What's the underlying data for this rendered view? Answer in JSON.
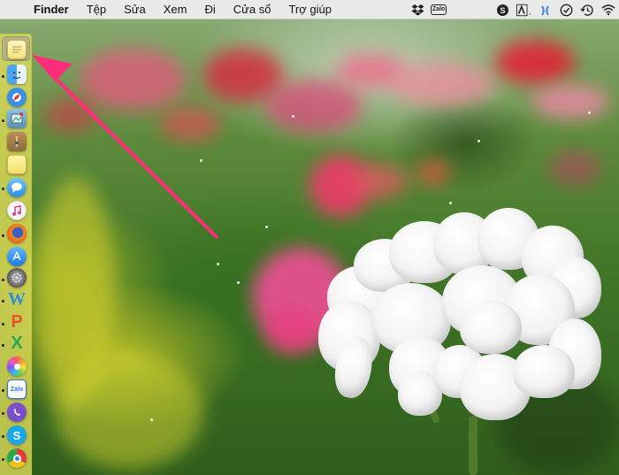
{
  "menubar": {
    "apple_icon": "",
    "app_name": "Finder",
    "items": [
      "Tệp",
      "Sửa",
      "Xem",
      "Đi",
      "Cửa sổ",
      "Trợ giúp"
    ],
    "status_icons": [
      "dropbox-icon",
      "zalo-icon",
      "skype-icon",
      "adobe-icon",
      "qdisk-icon",
      "todo-icon",
      "time-machine-icon",
      "wifi-icon"
    ],
    "zalo_text": "Zalo",
    "adobe_text": "A"
  },
  "dock": {
    "items": [
      {
        "name": "notes",
        "label": ""
      },
      {
        "name": "finder",
        "label": ""
      },
      {
        "name": "safari",
        "label": ""
      },
      {
        "name": "preview",
        "label": ""
      },
      {
        "name": "archive",
        "label": ""
      },
      {
        "name": "stickies",
        "label": ""
      },
      {
        "name": "messages",
        "label": ""
      },
      {
        "name": "itunes",
        "label": ""
      },
      {
        "name": "firefox",
        "label": ""
      },
      {
        "name": "app-store",
        "label": ""
      },
      {
        "name": "system-preferences",
        "label": ""
      },
      {
        "name": "word",
        "label": "W"
      },
      {
        "name": "powerpoint",
        "label": "P"
      },
      {
        "name": "excel",
        "label": "X"
      },
      {
        "name": "photos",
        "label": ""
      },
      {
        "name": "zalo",
        "label": "Zalo"
      },
      {
        "name": "viber",
        "label": ""
      },
      {
        "name": "skype",
        "label": "S"
      },
      {
        "name": "chrome",
        "label": ""
      }
    ]
  },
  "colors": {
    "annotation": "#ff2d7a",
    "dock_bg": "#e1de5a",
    "menubar_bg": "#ececec"
  }
}
